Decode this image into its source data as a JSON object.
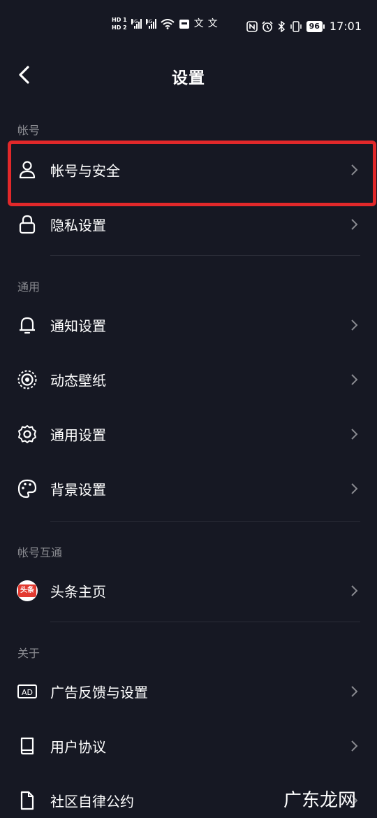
{
  "status_bar": {
    "hd1": "HD 1",
    "hd2": "HD 2",
    "net1": "4G",
    "net2": "4G",
    "battery": "96",
    "time": "17:01"
  },
  "header": {
    "title": "设置"
  },
  "sections": {
    "account": {
      "label": "帐号",
      "items": [
        {
          "label": "帐号与安全",
          "icon": "user-icon"
        },
        {
          "label": "隐私设置",
          "icon": "lock-icon"
        }
      ]
    },
    "general": {
      "label": "通用",
      "items": [
        {
          "label": "通知设置",
          "icon": "bell-icon"
        },
        {
          "label": "动态壁纸",
          "icon": "live-wallpaper-icon"
        },
        {
          "label": "通用设置",
          "icon": "gear-icon"
        },
        {
          "label": "背景设置",
          "icon": "palette-icon"
        }
      ]
    },
    "linked": {
      "label": "帐号互通",
      "items": [
        {
          "label": "头条主页",
          "icon": "toutiao-icon",
          "badge_text": "头条"
        }
      ]
    },
    "about": {
      "label": "关于",
      "items": [
        {
          "label": "广告反馈与设置",
          "icon": "ad-icon"
        },
        {
          "label": "用户协议",
          "icon": "book-icon"
        },
        {
          "label": "社区自律公约",
          "icon": "document-icon"
        }
      ]
    }
  },
  "watermark": "广东龙网",
  "colors": {
    "background": "#161823",
    "highlight": "#e1282a",
    "section_label": "#8a8b91"
  }
}
